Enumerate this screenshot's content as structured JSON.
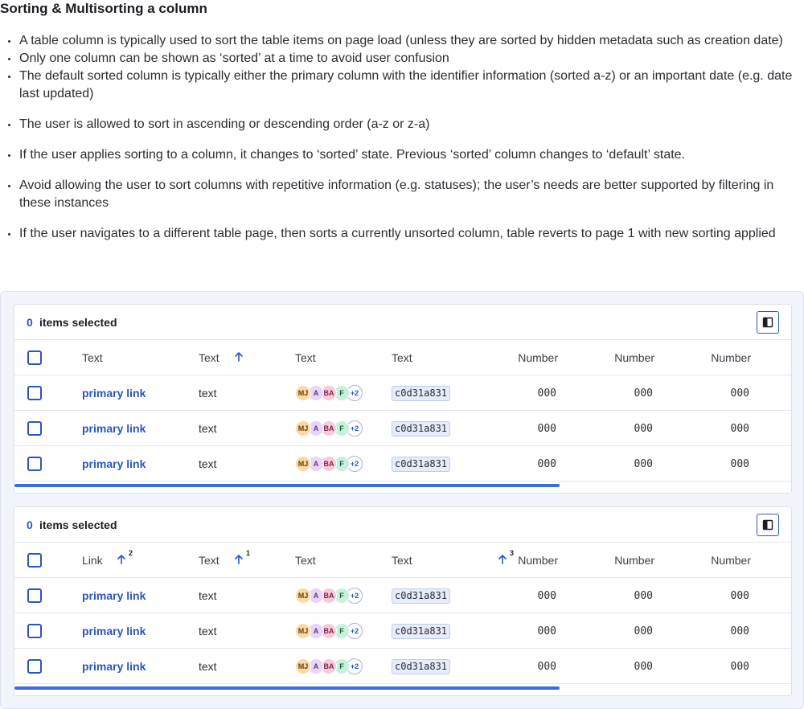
{
  "title": "Sorting & Multisorting a column",
  "bullets": [
    "A table column is typically used to sort the table items on page load (unless they are sorted by hidden metadata such as creation date)",
    "Only one column can be shown as ‘sorted’ at a time to avoid user confusion",
    "The default sorted column is typically either the primary column with the identifier information (sorted a-z) or an important date (e.g. date last updated)",
    "The user is allowed to sort in ascending or descending order (a-z or z-a)",
    "If the user applies sorting to a column, it changes to ‘sorted’ state. Previous ‘sorted’ column changes to ‘default’ state.",
    "Avoid allowing the user to sort columns with repetitive information (e.g. statuses); the user’s needs are better supported by filtering in these instances",
    "If the user navigates to a different table page, then sorts a currently unsorted column, table reverts to page 1 with new sorting applied"
  ],
  "colors": {
    "accent": "#2a55c7",
    "scrollbar": "#3a6ee0",
    "panel_bg": "#f2f4fb"
  },
  "tables": [
    {
      "selected_count": "0",
      "selected_label": "items selected",
      "columns_button_icon": "columns-icon",
      "headers": [
        "Text",
        "Text",
        "Text",
        "Text",
        "Number",
        "Number",
        "Number"
      ],
      "sort_markers": [
        {
          "column": 1,
          "direction": "ascending",
          "order": ""
        }
      ],
      "rows": [
        {
          "link": "primary link",
          "text": "text",
          "avatars": [
            "MJ",
            "A",
            "BA",
            "F",
            "+2"
          ],
          "code": "c0d31a831",
          "n1": "000",
          "n2": "000",
          "n3": "000"
        },
        {
          "link": "primary link",
          "text": "text",
          "avatars": [
            "MJ",
            "A",
            "BA",
            "F",
            "+2"
          ],
          "code": "c0d31a831",
          "n1": "000",
          "n2": "000",
          "n3": "000"
        },
        {
          "link": "primary link",
          "text": "text",
          "avatars": [
            "MJ",
            "A",
            "BA",
            "F",
            "+2"
          ],
          "code": "c0d31a831",
          "n1": "000",
          "n2": "000",
          "n3": "000"
        }
      ]
    },
    {
      "selected_count": "0",
      "selected_label": "items selected",
      "columns_button_icon": "columns-icon",
      "headers": [
        "Link",
        "Text",
        "Text",
        "Text",
        "Number",
        "Number",
        "Number"
      ],
      "sort_markers": [
        {
          "column": 0,
          "direction": "ascending",
          "order": "2"
        },
        {
          "column": 1,
          "direction": "ascending",
          "order": "1"
        },
        {
          "column": 4,
          "direction": "ascending",
          "order": "3"
        }
      ],
      "rows": [
        {
          "link": "primary link",
          "text": "text",
          "avatars": [
            "MJ",
            "A",
            "BA",
            "F",
            "+2"
          ],
          "code": "c0d31a831",
          "n1": "000",
          "n2": "000",
          "n3": "000"
        },
        {
          "link": "primary link",
          "text": "text",
          "avatars": [
            "MJ",
            "A",
            "BA",
            "F",
            "+2"
          ],
          "code": "c0d31a831",
          "n1": "000",
          "n2": "000",
          "n3": "000"
        },
        {
          "link": "primary link",
          "text": "text",
          "avatars": [
            "MJ",
            "A",
            "BA",
            "F",
            "+2"
          ],
          "code": "c0d31a831",
          "n1": "000",
          "n2": "000",
          "n3": "000"
        }
      ]
    }
  ]
}
